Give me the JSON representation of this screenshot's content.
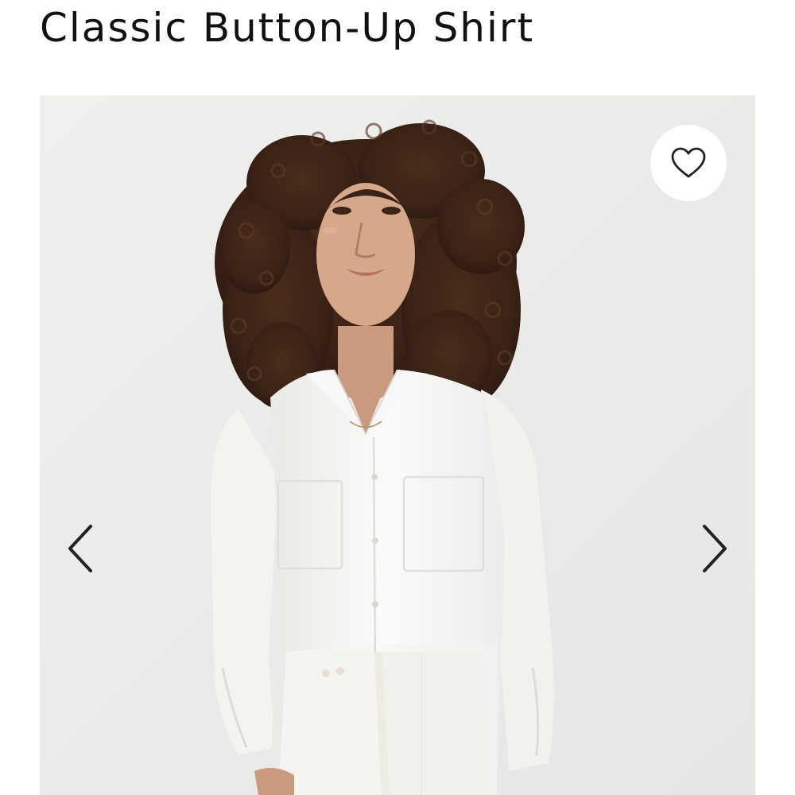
{
  "product": {
    "title": "Classic Button-Up Shirt"
  },
  "gallery": {
    "favorite_icon": "heart-outline-icon",
    "prev_icon": "chevron-left-icon",
    "next_icon": "chevron-right-icon"
  },
  "colors": {
    "text": "#111111",
    "background": "#ffffff",
    "photo_backdrop": "#ebebe9",
    "icon": "#222222"
  }
}
